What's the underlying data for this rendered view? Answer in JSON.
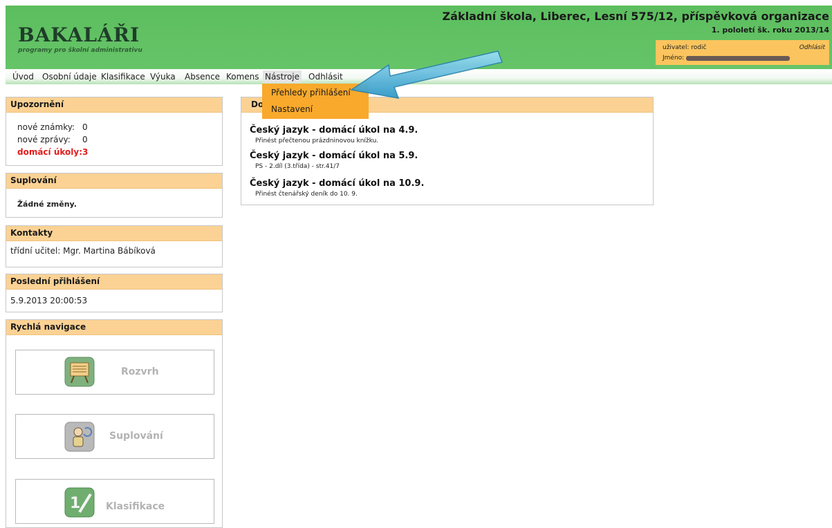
{
  "header": {
    "logo": "BAKALÁŘI",
    "logo_subtitle": "programy pro školní administrativu",
    "school_name": "Základní škola, Liberec, Lesní 575/12, příspěvková organizace",
    "term": "1. pololetí šk. roku 2013/14",
    "user": {
      "user_line": "uživatel: rodič",
      "name_line": "Jméno: o:",
      "logout": "Odhlásit"
    }
  },
  "menu": {
    "items": [
      "Úvod",
      "Osobní údaje",
      "Klasifikace",
      "Výuka",
      "Absence",
      "Komens",
      "Nástroje",
      "Odhlásit"
    ],
    "dropdown": [
      "Přehledy přihlášení",
      "Nastavení"
    ]
  },
  "notices": {
    "title": "Upozornění",
    "new_grades_label": "nové známky:",
    "new_grades_value": "0",
    "new_messages_label": "nové zprávy:",
    "new_messages_value": "0",
    "homework_label": "domácí úkoly:",
    "homework_value": "3"
  },
  "substitution": {
    "title": "Suplování",
    "text": "Žádné změny."
  },
  "contacts": {
    "title": "Kontakty",
    "text": "třídní učitel: Mgr. Martina Bábíková"
  },
  "last_login": {
    "title": "Poslední přihlášení",
    "text": "5.9.2013 20:00:53"
  },
  "quicknav": {
    "title": "Rychlá navigace",
    "buttons": [
      "Rozvrh",
      "Suplování",
      "Klasifikace"
    ]
  },
  "homework": {
    "title_visible": "Do",
    "items": [
      {
        "subject": "Český jazyk",
        "title": "domácí úkol na 4.9.",
        "desc": "Přinést přečtenou prázdninovou knížku."
      },
      {
        "subject": "Český jazyk",
        "title": "domácí úkol na 5.9.",
        "desc": "PS - 2.díl (3.třída) - str.41/7"
      },
      {
        "subject": "Český jazyk",
        "title": "domácí úkol na 10.9.",
        "desc": "Přinést čtenářský deník do 10. 9."
      }
    ]
  },
  "colors": {
    "header_green": "#5cbe5e",
    "panel_header": "#fbd294",
    "dropdown": "#f9a92c",
    "alert_red": "#e31c1c",
    "arrow": "#4fb6dc"
  }
}
